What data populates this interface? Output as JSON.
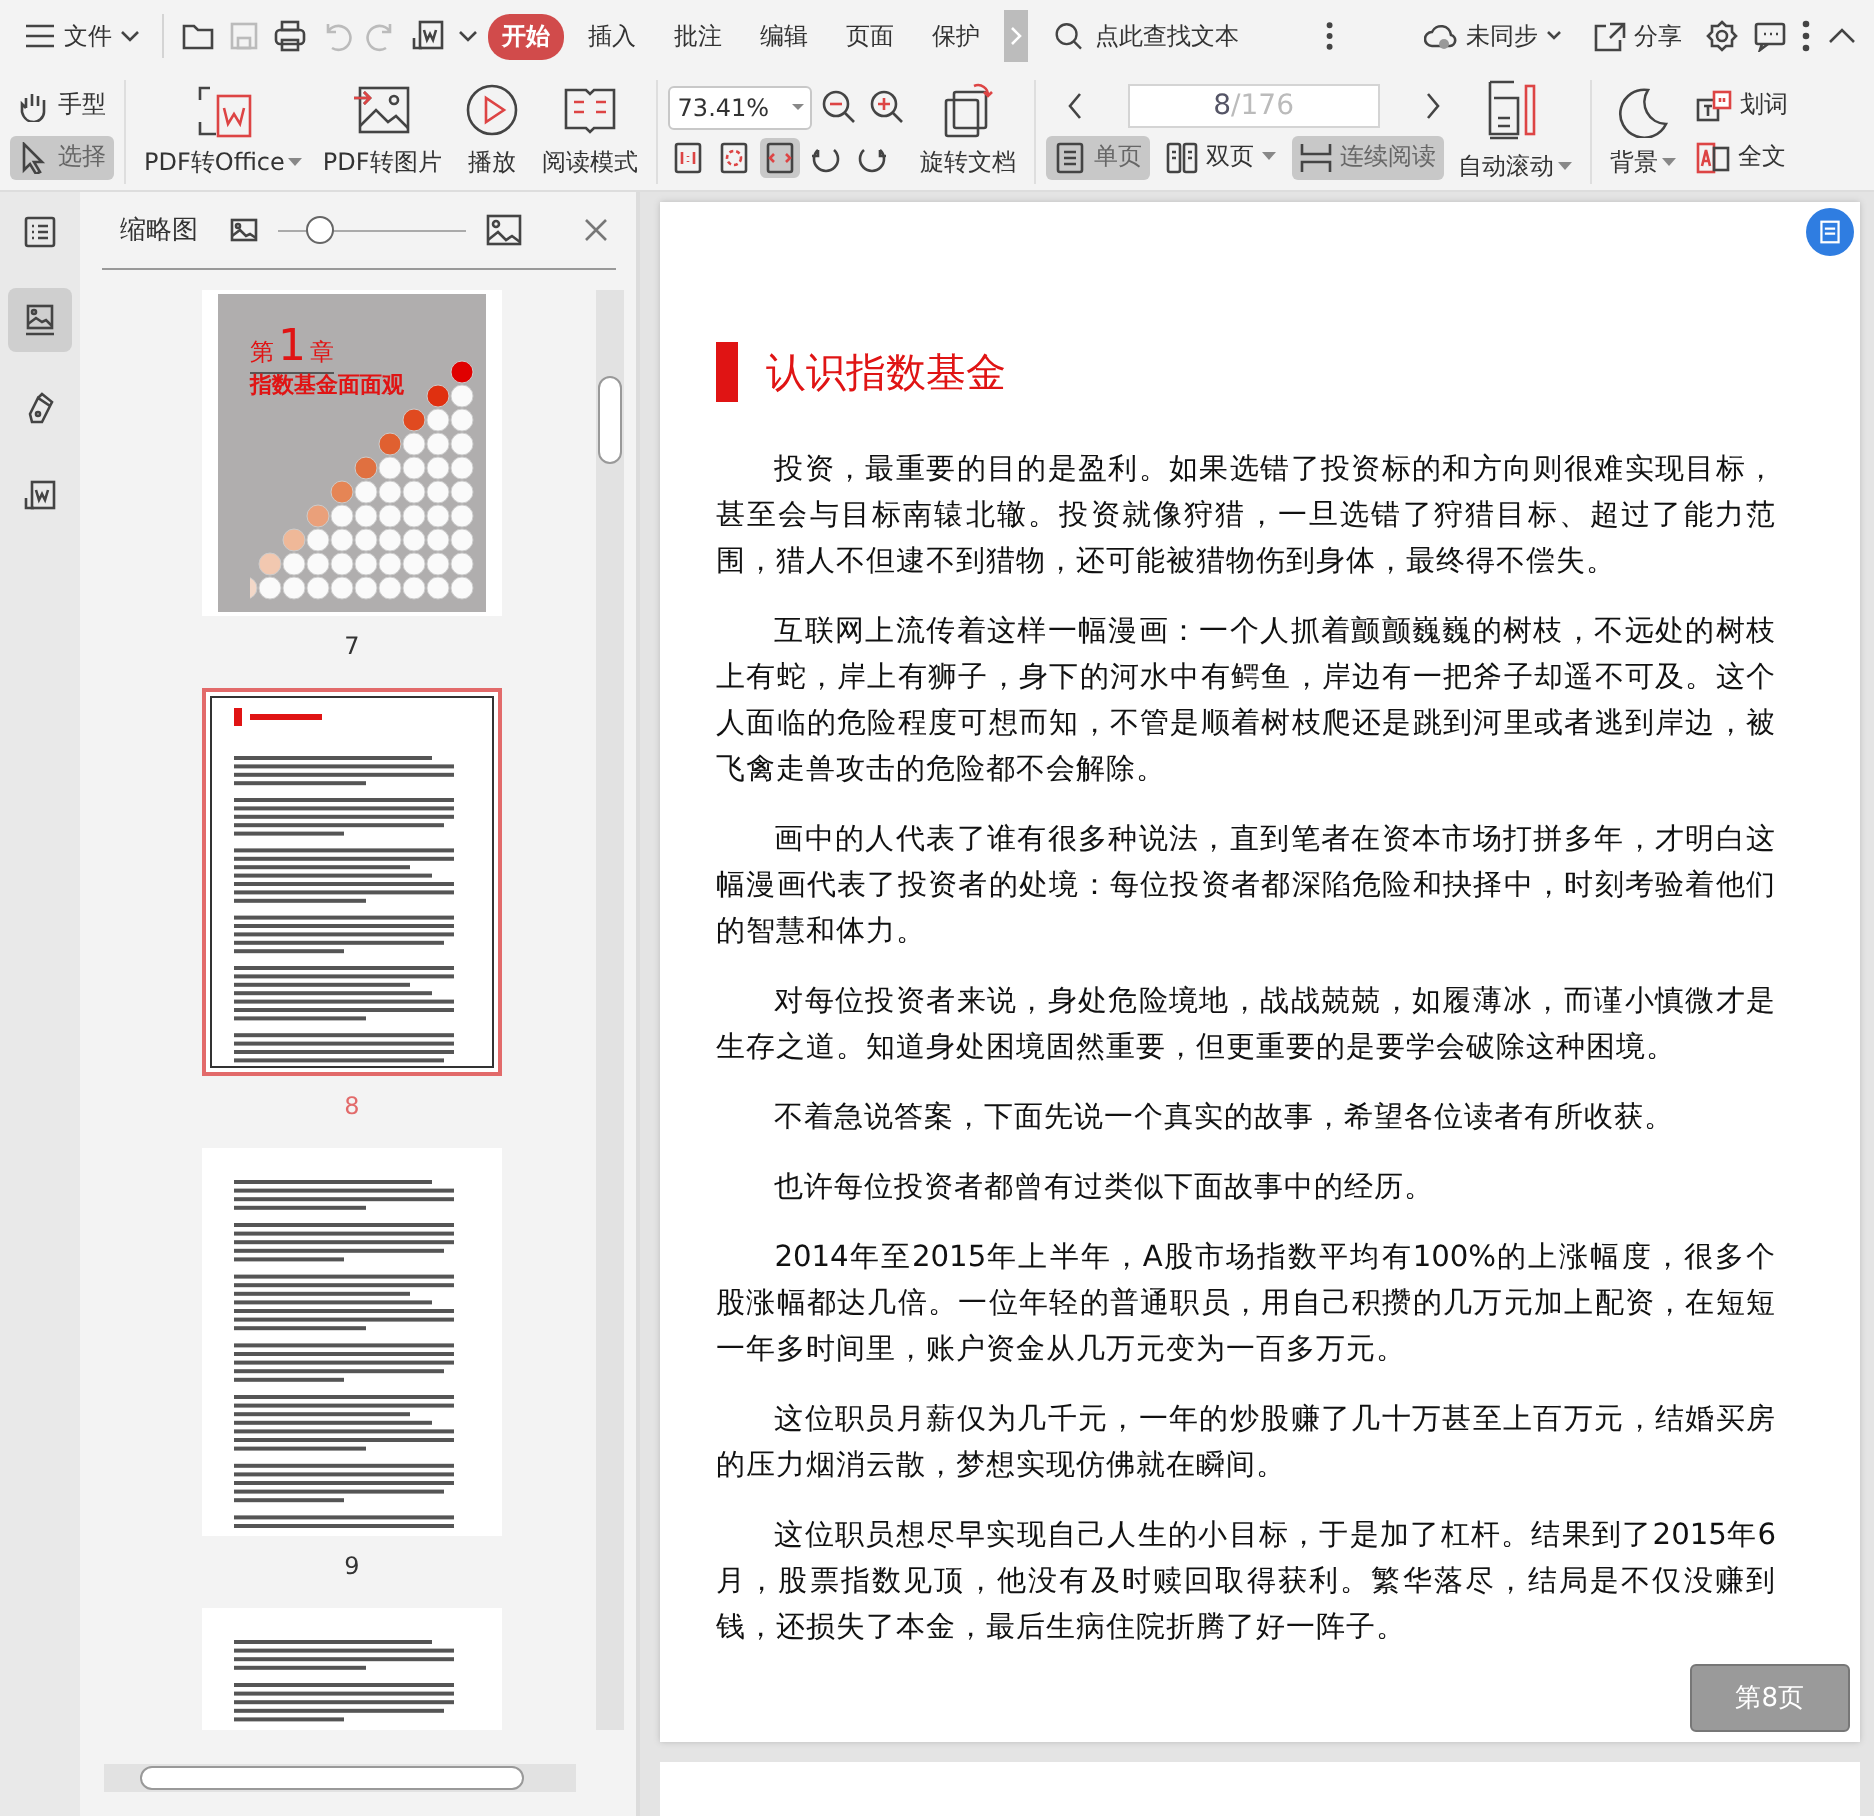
{
  "menubar": {
    "file_menu": "文件",
    "tabs": [
      {
        "label": "开始",
        "selected": true
      },
      {
        "label": "插入",
        "selected": false
      },
      {
        "label": "批注",
        "selected": false
      },
      {
        "label": "编辑",
        "selected": false
      },
      {
        "label": "页面",
        "selected": false
      },
      {
        "label": "保护",
        "selected": false
      }
    ],
    "search": {
      "placeholder": "点此查找文本"
    },
    "sync": "未同步",
    "share": "分享"
  },
  "toolbar": {
    "tools": [
      {
        "label": "手型",
        "kind": "hand",
        "selected": false
      },
      {
        "label": "选择",
        "kind": "select",
        "selected": true
      }
    ],
    "big_buttons": [
      {
        "label": "PDF转Office",
        "kind": "convert",
        "dropdown": true
      },
      {
        "label": "PDF转图片",
        "kind": "image",
        "dropdown": false
      },
      {
        "label": "播放",
        "kind": "play",
        "dropdown": false
      },
      {
        "label": "阅读模式",
        "kind": "book",
        "dropdown": false
      }
    ],
    "zoom": "73.41%",
    "fit_modes": [
      {
        "kind": "actual",
        "selected": false
      },
      {
        "kind": "fit-page",
        "selected": false
      },
      {
        "kind": "fit-width",
        "selected": true
      }
    ],
    "rotate": "旋转文档",
    "page": {
      "current": "8",
      "total": "/176"
    },
    "view_modes": [
      {
        "label": "单页",
        "kind": "single",
        "selected": true,
        "dropdown": false
      },
      {
        "label": "双页",
        "kind": "double",
        "selected": false,
        "dropdown": true
      },
      {
        "label": "连续阅读",
        "kind": "continuous",
        "selected": true,
        "dropdown": false
      }
    ],
    "auto_scroll": "自动滚动",
    "background": "背景",
    "translate_word": "划词",
    "translate_full": "全文"
  },
  "sidebar": {
    "items": [
      {
        "kind": "outline",
        "selected": false
      },
      {
        "kind": "thumbnails",
        "selected": true
      },
      {
        "kind": "annotate",
        "selected": false
      },
      {
        "kind": "export",
        "selected": false
      }
    ]
  },
  "thumbnail_panel": {
    "title": "缩略图",
    "size_slider": {
      "level": 0.22
    },
    "pages": [
      {
        "kind": "cover",
        "label": "7",
        "selected": false,
        "chapter_prefix": "第",
        "chapter_number": "1",
        "chapter_suffix": "章",
        "chapter_title": "指数基金面面观"
      },
      {
        "kind": "text",
        "label": "8",
        "selected": true
      },
      {
        "kind": "text",
        "label": "9",
        "selected": false
      },
      {
        "kind": "text",
        "selected": false
      }
    ]
  },
  "document": {
    "title": "认识指数基金",
    "paragraphs": [
      "投资，最重要的目的是盈利。如果选错了投资标的和方向则很难实现目标，甚至会与目标南辕北辙。投资就像狩猎，一旦选错了狩猎目标、超过了能力范围，猎人不但逮不到猎物，还可能被猎物伤到身体，最终得不偿失。",
      "互联网上流传着这样一幅漫画：一个人抓着颤颤巍巍的树枝，不远处的树枝上有蛇，岸上有狮子，身下的河水中有鳄鱼，岸边有一把斧子却遥不可及。这个人面临的危险程度可想而知，不管是顺着树枝爬还是跳到河里或者逃到岸边，被飞禽走兽攻击的危险都不会解除。",
      "画中的人代表了谁有很多种说法，直到笔者在资本市场打拼多年，才明白这幅漫画代表了投资者的处境：每位投资者都深陷危险和抉择中，时刻考验着他们的智慧和体力。",
      "对每位投资者来说，身处危险境地，战战兢兢，如履薄冰，而谨小慎微才是生存之道。知道身处困境固然重要，但更重要的是要学会破除这种困境。",
      "不着急说答案，下面先说一个真实的故事，希望各位读者有所收获。",
      "也许每位投资者都曾有过类似下面故事中的经历。",
      "2014年至2015年上半年，A股市场指数平均有100%的上涨幅度，很多个股涨幅都达几倍。一位年轻的普通职员，用自己积攒的几万元加上配资，在短短一年多时间里，账户资金从几万元变为一百多万元。",
      "这位职员月薪仅为几千元，一年的炒股赚了几十万甚至上百万元，结婚买房的压力烟消云散，梦想实现仿佛就在瞬间。",
      "这位职员想尽早实现自己人生的小目标，于是加了杠杆。结果到了2015年6月，股票指数见顶，他没有及时赎回取得获利。繁华落尽，结局是不仅没赚到钱，还损失了本金，最后生病住院折腾了好一阵子。"
    ],
    "page_badge": "第8页"
  }
}
